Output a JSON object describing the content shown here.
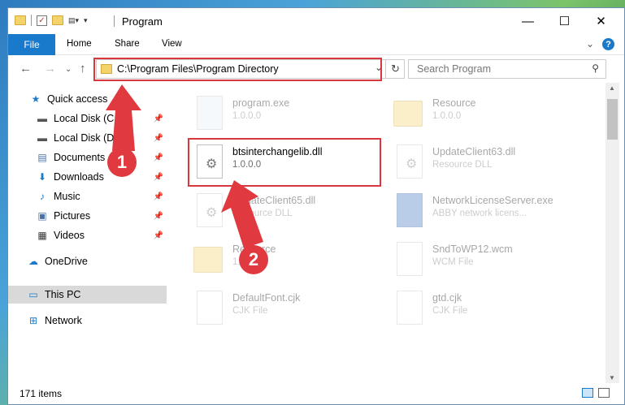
{
  "window": {
    "title": "Program",
    "controls": {
      "minimize": "—",
      "maximize": "☐",
      "close": "✕"
    }
  },
  "ribbon": {
    "tabs": [
      "File",
      "Home",
      "Share",
      "View"
    ],
    "expand_icon": "⌄",
    "help_icon": "?"
  },
  "nav": {
    "address": "C:\\Program Files\\Program Directory",
    "search_placeholder": "Search Program"
  },
  "sidebar": {
    "items": [
      {
        "label": "Quick access",
        "icon": "star-icon",
        "pinned": false
      },
      {
        "label": "Local Disk (C:)",
        "icon": "drive-icon",
        "pinned": true
      },
      {
        "label": "Local Disk (D:)",
        "icon": "drive-icon",
        "pinned": true
      },
      {
        "label": "Documents",
        "icon": "documents-icon",
        "pinned": true
      },
      {
        "label": "Downloads",
        "icon": "download-icon",
        "pinned": true
      },
      {
        "label": "Music",
        "icon": "music-icon",
        "pinned": true
      },
      {
        "label": "Pictures",
        "icon": "pictures-icon",
        "pinned": true
      },
      {
        "label": "Videos",
        "icon": "videos-icon",
        "pinned": true
      },
      {
        "label": "OneDrive",
        "icon": "cloud-icon",
        "pinned": false
      },
      {
        "label": "This PC",
        "icon": "computer-icon",
        "pinned": false,
        "selected": true
      },
      {
        "label": "Network",
        "icon": "network-icon",
        "pinned": false
      }
    ]
  },
  "files": [
    {
      "name": "program.exe",
      "sub": "1.0.0.0",
      "type": "exe",
      "faded": true
    },
    {
      "name": "Resource",
      "sub": "1.0.0.0",
      "type": "folder",
      "faded": true
    },
    {
      "name": "btsinterchangelib.dll",
      "sub": "1.0.0.0",
      "type": "dll",
      "faded": false
    },
    {
      "name": "UpdateClient63.dll",
      "sub": "Resource DLL",
      "type": "dll",
      "faded": true
    },
    {
      "name": "UpdateClient65.dll",
      "sub": "Resource DLL",
      "type": "dll",
      "faded": true
    },
    {
      "name": "NetworkLicenseServer.exe",
      "sub": "ABBY network licens...",
      "type": "exe",
      "faded": true
    },
    {
      "name": "Resource",
      "sub": "1.0.0.0",
      "type": "folder",
      "faded": true
    },
    {
      "name": "SndToWP12.wcm",
      "sub": "WCM File",
      "type": "doc",
      "faded": true
    },
    {
      "name": "DefaultFont.cjk",
      "sub": "CJK File",
      "type": "doc",
      "faded": true
    },
    {
      "name": "gtd.cjk",
      "sub": "CJK File",
      "type": "doc",
      "faded": true
    }
  ],
  "annotations": {
    "badge1": "1",
    "badge2": "2",
    "color": "#e03a40"
  },
  "status": {
    "item_count": "171 items"
  }
}
